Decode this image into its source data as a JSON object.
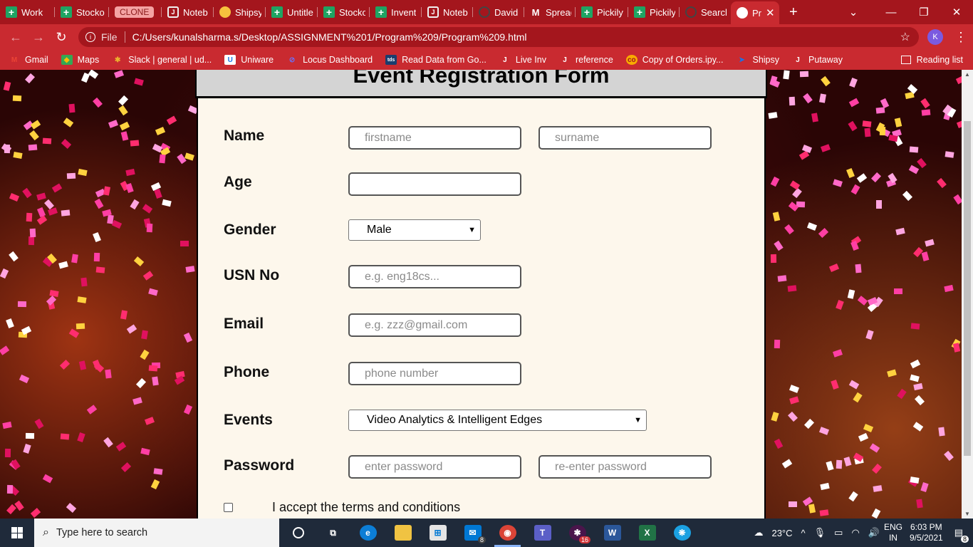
{
  "browser": {
    "tabs": [
      {
        "title": "Work",
        "icon": "sheets-icon"
      },
      {
        "title": "Stocko",
        "icon": "sheets-icon"
      },
      {
        "title": "CLONE",
        "icon": "clone-chip"
      },
      {
        "title": "Noteb",
        "icon": "notebook-icon"
      },
      {
        "title": "Shipsy",
        "icon": "shipsy-icon"
      },
      {
        "title": "Untitle",
        "icon": "sheets-icon"
      },
      {
        "title": "Stocko",
        "icon": "sheets-icon"
      },
      {
        "title": "Invent",
        "icon": "sheets-icon"
      },
      {
        "title": "Noteb",
        "icon": "notebook-icon"
      },
      {
        "title": "David",
        "icon": "github-icon"
      },
      {
        "title": "Spread",
        "icon": "gmail-icon"
      },
      {
        "title": "Pickily",
        "icon": "sheets-icon"
      },
      {
        "title": "Pickily",
        "icon": "sheets-icon"
      },
      {
        "title": "Search",
        "icon": "github-icon"
      },
      {
        "title": "Pr",
        "icon": "globe-icon"
      }
    ],
    "address": {
      "scheme_label": "File",
      "url": "C:/Users/kunalsharma.s/Desktop/ASSIGNMENT%201/Program%209/Program%209.html"
    },
    "profile_initial": "K",
    "bookmarks": [
      {
        "label": "Gmail",
        "icon": "gmail-icon"
      },
      {
        "label": "Maps",
        "icon": "maps-icon"
      },
      {
        "label": "Slack | general | ud...",
        "icon": "slack-icon"
      },
      {
        "label": "Uniware",
        "icon": "uniware-icon"
      },
      {
        "label": "Locus Dashboard",
        "icon": "locus-icon"
      },
      {
        "label": "Read Data from Go...",
        "icon": "tds-icon"
      },
      {
        "label": "Live Inv",
        "icon": "notebook-icon"
      },
      {
        "label": "reference",
        "icon": "notebook-icon"
      },
      {
        "label": "Copy of Orders.ipy...",
        "icon": "colab-icon"
      },
      {
        "label": "Shipsy",
        "icon": "shipsy-icon"
      },
      {
        "label": "Putaway",
        "icon": "notebook-icon"
      }
    ],
    "reading_list": "Reading list"
  },
  "form": {
    "title": "Event Registration Form",
    "name_label": "Name",
    "firstname_placeholder": "firstname",
    "surname_placeholder": "surname",
    "age_label": "Age",
    "age_value": "",
    "gender_label": "Gender",
    "gender_value": "Male",
    "usn_label": "USN No",
    "usn_placeholder": "e.g. eng18cs...",
    "email_label": "Email",
    "email_placeholder": "e.g. zzz@gmail.com",
    "phone_label": "Phone",
    "phone_placeholder": "phone number",
    "events_label": "Events",
    "events_value": "Video Analytics & Intelligent Edges",
    "password_label": "Password",
    "password_placeholder": "enter password",
    "repassword_placeholder": "re-enter password",
    "terms_label": "I accept the terms and conditions"
  },
  "taskbar": {
    "search_placeholder": "Type here to search",
    "mail_badge": "8",
    "slack_badge": "16",
    "weather": "23°C",
    "lang_top": "ENG",
    "lang_bottom": "IN",
    "time": "6:03 PM",
    "date": "9/5/2021",
    "notif_count": "8"
  },
  "colors": {
    "tabstrip": "#a4161d",
    "toolbar": "#c92a30",
    "form_bg": "#fdf7ec",
    "header_bg": "#d4d4d4"
  }
}
